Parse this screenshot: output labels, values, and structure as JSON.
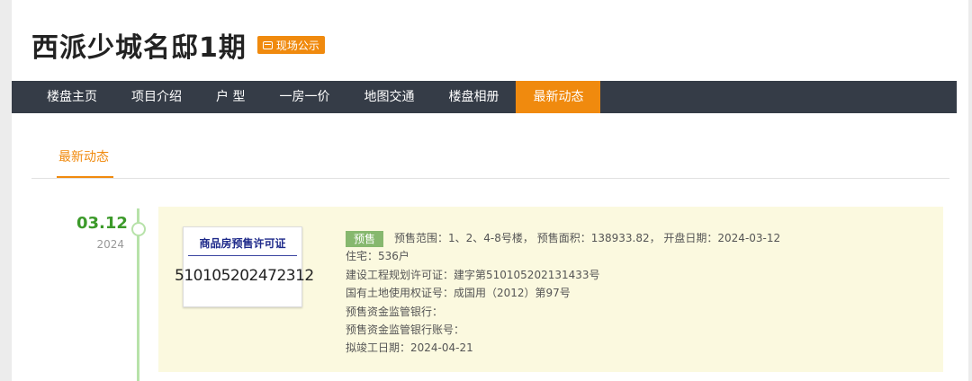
{
  "project": {
    "name": "西派少城名邸1期",
    "badge_label": "现场公示"
  },
  "nav": {
    "items": [
      "楼盘主页",
      "项目介绍",
      "户 型",
      "一房一价",
      "地图交通",
      "楼盘相册",
      "最新动态"
    ],
    "active_index": 6
  },
  "subtab": {
    "label": "最新动态"
  },
  "timeline": [
    {
      "date": "03.12",
      "year": "2024",
      "permit_card": {
        "title": "商品房预售许可证",
        "number": "510105202472312"
      },
      "tag": "预售",
      "summary": "预售范围：1、2、4-8号楼，  预售面积：138933.82，  开盘日期：2024-03-12",
      "lines": [
        "住宅：536户",
        "建设工程规划许可证：建字第510105202131433号",
        "国有土地使用权证号：成国用（2012）第97号",
        "预售资金监管银行：",
        "预售资金监管银行账号：",
        "拟竣工日期：2024-04-21"
      ]
    }
  ],
  "colors": {
    "accent": "#f08a0e",
    "nav_bg": "#353c47",
    "date_green": "#3c9a2a",
    "timeline_line": "#b7e2a9",
    "card_bg": "#fbf9df",
    "tag_green": "#86b86e",
    "permit_title": "#1e2a8a"
  },
  "icons": {
    "badge_icon": "screen-icon"
  }
}
